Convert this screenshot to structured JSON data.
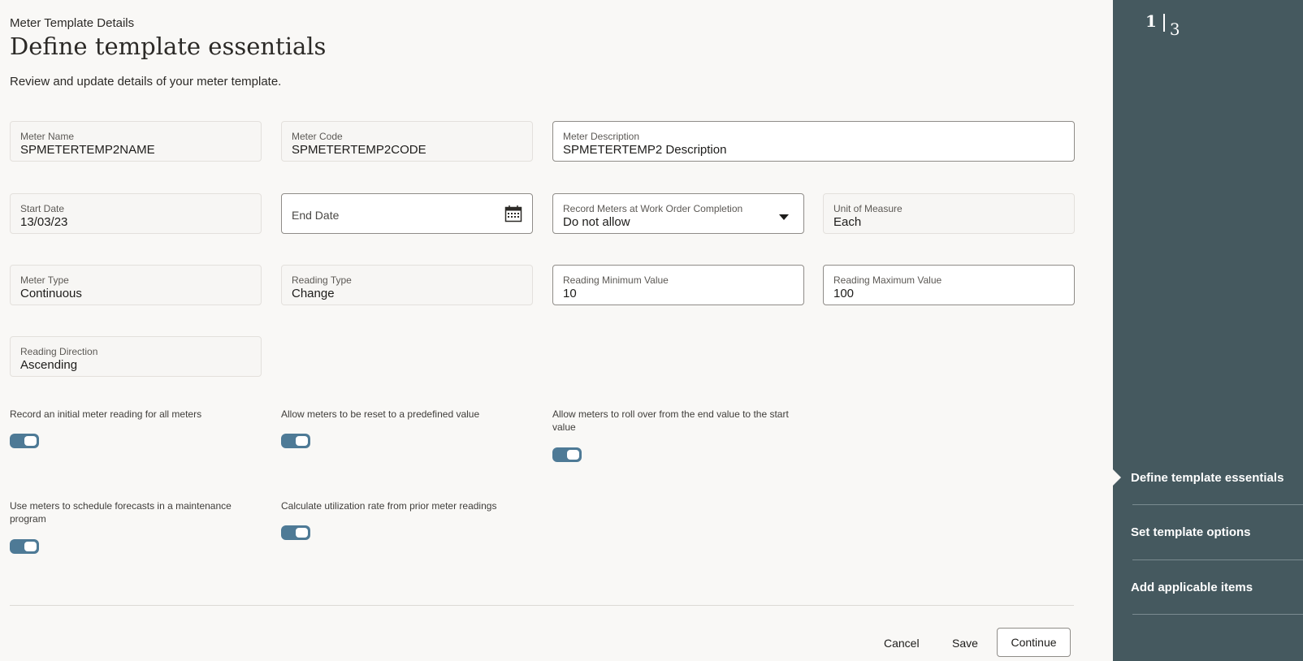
{
  "header": {
    "subtitle": "Meter Template Details",
    "title": "Define template essentials",
    "description": "Review and update details of your meter template."
  },
  "fields": {
    "meter_name": {
      "label": "Meter Name",
      "value": "SPMETERTEMP2NAME"
    },
    "meter_code": {
      "label": "Meter Code",
      "value": "SPMETERTEMP2CODE"
    },
    "meter_description": {
      "label": "Meter Description",
      "value": "SPMETERTEMP2 Description"
    },
    "start_date": {
      "label": "Start Date",
      "value": "13/03/23"
    },
    "end_date": {
      "placeholder": "End Date",
      "icon": "calendar-icon"
    },
    "record_meters": {
      "label": "Record Meters at Work Order Completion",
      "value": "Do not allow",
      "icon": "chevron-down-icon"
    },
    "unit_of_measure": {
      "label": "Unit of Measure",
      "value": "Each"
    },
    "meter_type": {
      "label": "Meter Type",
      "value": "Continuous"
    },
    "reading_type": {
      "label": "Reading Type",
      "value": "Change"
    },
    "reading_min": {
      "label": "Reading Minimum Value",
      "value": "10"
    },
    "reading_max": {
      "label": "Reading Maximum Value",
      "value": "100"
    },
    "reading_direction": {
      "label": "Reading Direction",
      "value": "Ascending"
    }
  },
  "toggles": [
    {
      "label": "Record an initial meter reading for all meters",
      "on": true
    },
    {
      "label": "Allow meters to be reset to a predefined value",
      "on": true
    },
    {
      "label": "Allow meters to roll over from the end value to the start value",
      "on": true
    },
    {
      "label": "Use meters to schedule forecasts in a maintenance program",
      "on": true
    },
    {
      "label": "Calculate utilization rate from prior meter readings",
      "on": true
    }
  ],
  "actions": {
    "cancel": "Cancel",
    "save": "Save",
    "continue": "Continue"
  },
  "progress": {
    "current": "1",
    "total": "3",
    "steps": [
      "Define template essentials",
      "Set template options",
      "Add applicable items"
    ],
    "active_index": 0
  },
  "colors": {
    "sidebar": "#45595f",
    "toggle_on": "#4e7a96",
    "background": "#f9f8f6"
  }
}
